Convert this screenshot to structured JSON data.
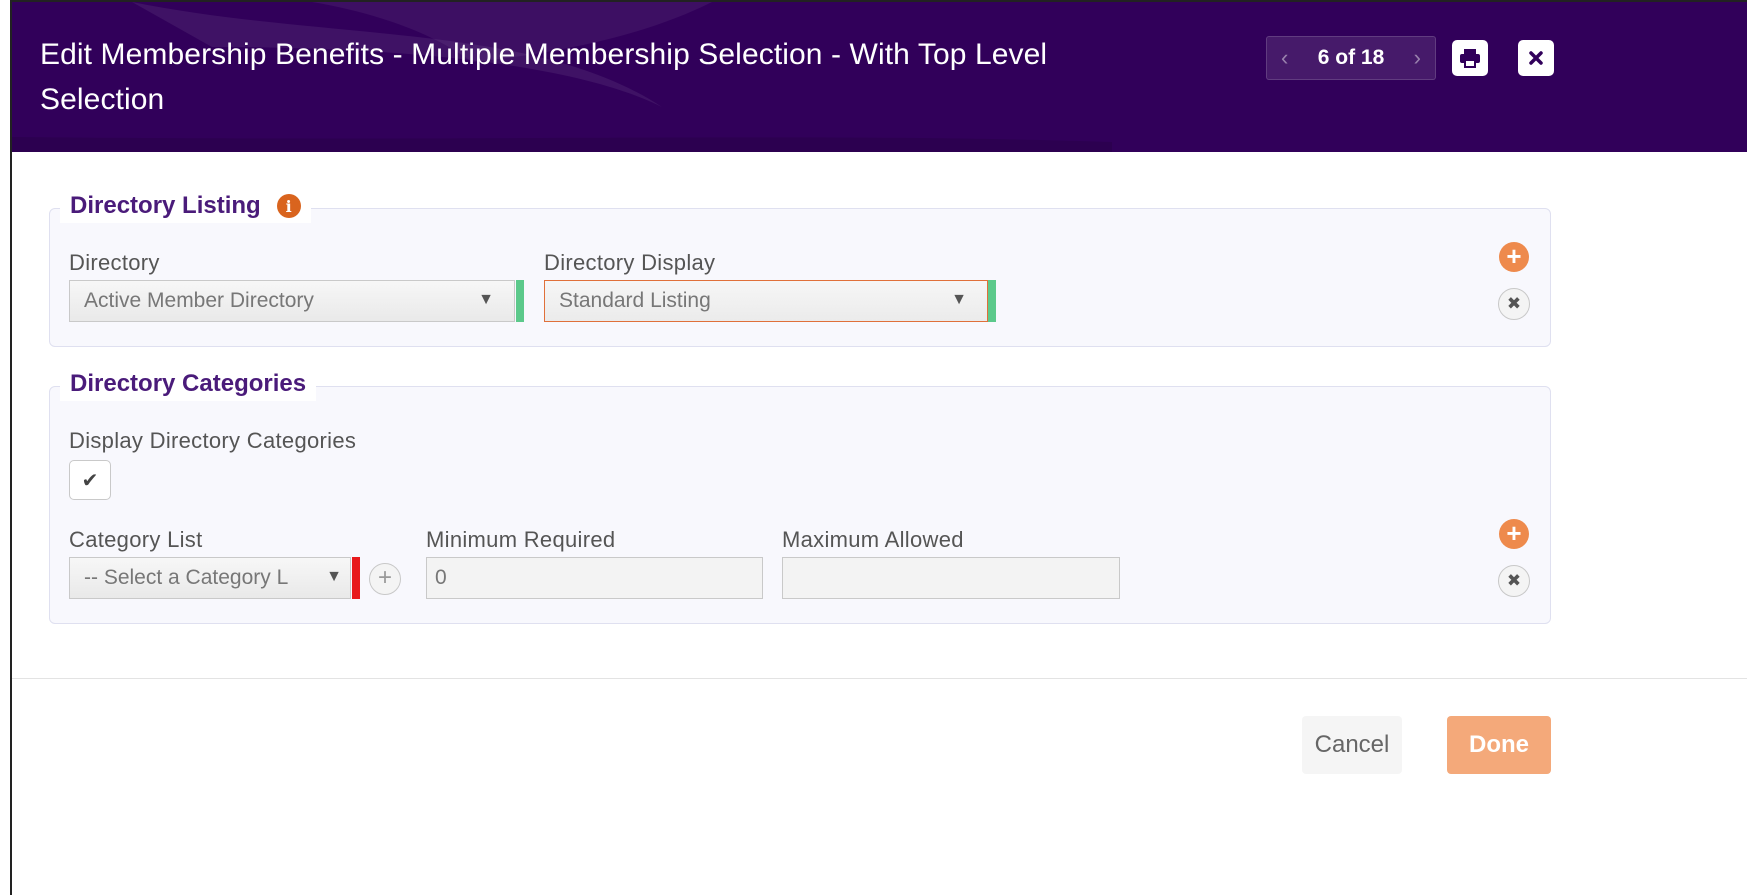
{
  "header": {
    "title": "Edit Membership Benefits - Multiple Membership Selection - With Top Level Selection",
    "pager": {
      "prev": "‹",
      "current": "6 of 18",
      "next": "›"
    },
    "print_icon": "print-icon",
    "close_icon": "close-icon",
    "colors": {
      "background": "#31005a"
    }
  },
  "directory_listing": {
    "legend": "Directory Listing",
    "info_icon": "i",
    "directory_label": "Directory",
    "directory_value": "Active Member Directory",
    "display_label": "Directory Display",
    "display_value": "Standard Listing"
  },
  "directory_categories": {
    "legend": "Directory Categories",
    "display_label": "Display Directory Categories",
    "display_checked": true,
    "category_label": "Category List",
    "category_value": "-- Select a Category L",
    "minimum_label": "Minimum Required",
    "minimum_value": "0",
    "maximum_label": "Maximum Allowed",
    "maximum_value": ""
  },
  "footer": {
    "cancel_label": "Cancel",
    "done_label": "Done"
  },
  "colors": {
    "accent_orange": "#ee8a4c",
    "valid_flag": "#5cc98b",
    "required_flag": "#e8191c",
    "legend_text": "#4a1b7a"
  }
}
